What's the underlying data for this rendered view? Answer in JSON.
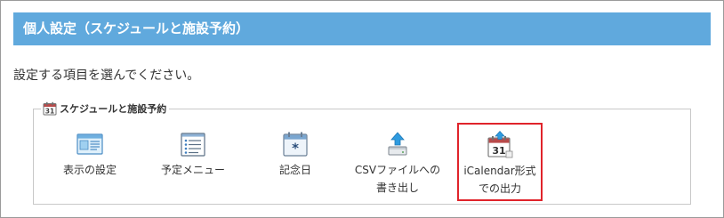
{
  "page": {
    "title": "個人設定（スケジュールと施設予約）",
    "instruction": "設定する項目を選んでください。"
  },
  "group": {
    "legend": "スケジュールと施設予約",
    "legend_icon": "calendar-31-icon",
    "items": [
      {
        "label_line1": "表示の設定",
        "label_line2": "",
        "icon": "display-settings-icon"
      },
      {
        "label_line1": "予定メニュー",
        "label_line2": "",
        "icon": "list-menu-icon"
      },
      {
        "label_line1": "記念日",
        "label_line2": "",
        "icon": "anniversary-calendar-icon"
      },
      {
        "label_line1": "CSVファイルへの",
        "label_line2": "書き出し",
        "icon": "export-upload-icon"
      },
      {
        "label_line1": "iCalendar形式",
        "label_line2": "での出力",
        "icon": "icalendar-export-icon",
        "highlighted": true
      }
    ]
  },
  "colors": {
    "title_bar": "#60a9dd",
    "highlight_border": "#e0242b",
    "text": "#333333"
  }
}
